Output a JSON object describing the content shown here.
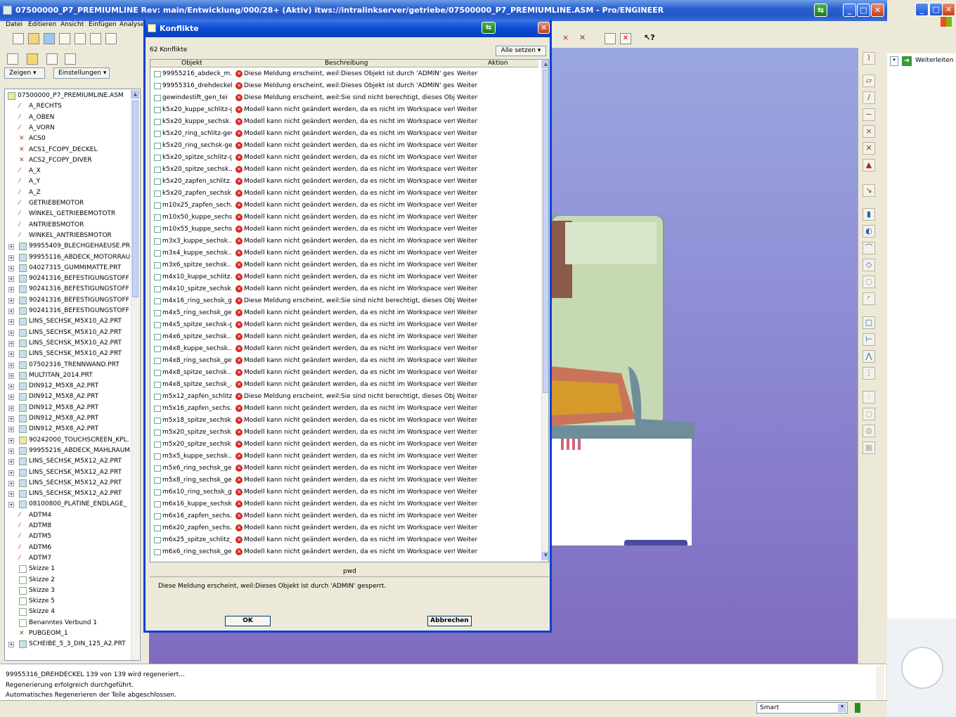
{
  "window": {
    "title": "07500000_P7_PREMIUMLINE Rev: main/Entwicklung/000/28+ (Aktiv) itws://intralinkserver/getriebe/07500000_P7_PREMIUMLINE.ASM - Pro/ENGINEER",
    "min": "_",
    "max": "□",
    "close": "✕"
  },
  "menu": [
    "Datei",
    "Editieren",
    "Ansicht",
    "Einfügen",
    "Analyse"
  ],
  "left_panel": {
    "zeigen": "Zeigen ▾",
    "einstellungen": "Einstellungen ▾",
    "tree": [
      {
        "label": "07500000_P7_PREMIUMLINE.ASM",
        "indent": 0,
        "expand": false,
        "kind": "asm"
      },
      {
        "label": "A_RECHTS",
        "indent": 1,
        "expand": false,
        "kind": "plane"
      },
      {
        "label": "A_OBEN",
        "indent": 1,
        "expand": false,
        "kind": "plane"
      },
      {
        "label": "A_VORN",
        "indent": 1,
        "expand": false,
        "kind": "plane"
      },
      {
        "label": "ACS0",
        "indent": 1,
        "expand": false,
        "kind": "csys"
      },
      {
        "label": "ACS1_FCOPY_DECKEL",
        "indent": 1,
        "expand": false,
        "kind": "csys"
      },
      {
        "label": "ACS2_FCOPY_DIVER",
        "indent": 1,
        "expand": false,
        "kind": "csys"
      },
      {
        "label": "A_X",
        "indent": 1,
        "expand": false,
        "kind": "axis"
      },
      {
        "label": "A_Y",
        "indent": 1,
        "expand": false,
        "kind": "axis"
      },
      {
        "label": "A_Z",
        "indent": 1,
        "expand": false,
        "kind": "axis"
      },
      {
        "label": "GETRIEBEMOTOR",
        "indent": 1,
        "expand": false,
        "kind": "axis"
      },
      {
        "label": "WINKEL_GETRIEBEMOTOTR",
        "indent": 1,
        "expand": false,
        "kind": "plane"
      },
      {
        "label": "ANTRIEBSMOTOR",
        "indent": 1,
        "expand": false,
        "kind": "axis"
      },
      {
        "label": "WINKEL_ANTRIEBSMOTOR",
        "indent": 1,
        "expand": false,
        "kind": "plane"
      },
      {
        "label": "99955409_BLECHGEHAEUSE.PR",
        "indent": 1,
        "expand": true,
        "kind": "part"
      },
      {
        "label": "99955116_ABDECK_MOTORRAU",
        "indent": 1,
        "expand": true,
        "kind": "part"
      },
      {
        "label": "04027315_GUMMIMATTE.PRT",
        "indent": 1,
        "expand": true,
        "kind": "part"
      },
      {
        "label": "90241316_BEFESTIGUNGSTOFF",
        "indent": 1,
        "expand": true,
        "kind": "part"
      },
      {
        "label": "90241316_BEFESTIGUNGSTOFF",
        "indent": 1,
        "expand": true,
        "kind": "part"
      },
      {
        "label": "90241316_BEFESTIGUNGSTOFF",
        "indent": 1,
        "expand": true,
        "kind": "part"
      },
      {
        "label": "90241316_BEFESTIGUNGSTOFF",
        "indent": 1,
        "expand": true,
        "kind": "part"
      },
      {
        "label": "LINS_SECHSK_M5X10_A2.PRT",
        "indent": 1,
        "expand": true,
        "kind": "part"
      },
      {
        "label": "LINS_SECHSK_M5X10_A2.PRT",
        "indent": 1,
        "expand": true,
        "kind": "part"
      },
      {
        "label": "LINS_SECHSK_M5X10_A2.PRT",
        "indent": 1,
        "expand": true,
        "kind": "part"
      },
      {
        "label": "LINS_SECHSK_M5X10_A2.PRT",
        "indent": 1,
        "expand": true,
        "kind": "part"
      },
      {
        "label": "07502316_TRENNWAND.PRT",
        "indent": 1,
        "expand": true,
        "kind": "part"
      },
      {
        "label": "MULTITAN_2014.PRT",
        "indent": 1,
        "expand": true,
        "kind": "part"
      },
      {
        "label": "DIN912_M5X8_A2.PRT",
        "indent": 1,
        "expand": true,
        "kind": "part"
      },
      {
        "label": "DIN912_M5X8_A2.PRT",
        "indent": 1,
        "expand": true,
        "kind": "part"
      },
      {
        "label": "DIN912_M5X8_A2.PRT",
        "indent": 1,
        "expand": true,
        "kind": "part"
      },
      {
        "label": "DIN912_M5X8_A2.PRT",
        "indent": 1,
        "expand": true,
        "kind": "part"
      },
      {
        "label": "DIN912_M5X8_A2.PRT",
        "indent": 1,
        "expand": true,
        "kind": "part"
      },
      {
        "label": "90242000_TOUCHSCREEN_KPL.",
        "indent": 1,
        "expand": true,
        "kind": "asm"
      },
      {
        "label": "99955216_ABDECK_MAHLRAUM.",
        "indent": 1,
        "expand": true,
        "kind": "part"
      },
      {
        "label": "LINS_SECHSK_M5X12_A2.PRT",
        "indent": 1,
        "expand": true,
        "kind": "part"
      },
      {
        "label": "LINS_SECHSK_M5X12_A2.PRT",
        "indent": 1,
        "expand": true,
        "kind": "part"
      },
      {
        "label": "LINS_SECHSK_M5X12_A2.PRT",
        "indent": 1,
        "expand": true,
        "kind": "part"
      },
      {
        "label": "LINS_SECHSK_M5X12_A2.PRT",
        "indent": 1,
        "expand": true,
        "kind": "part"
      },
      {
        "label": "08100800_PLATINE_ENDLAGE_",
        "indent": 1,
        "expand": true,
        "kind": "part"
      },
      {
        "label": "ADTM4",
        "indent": 1,
        "expand": false,
        "kind": "plane"
      },
      {
        "label": "ADTM8",
        "indent": 1,
        "expand": false,
        "kind": "plane"
      },
      {
        "label": "ADTM5",
        "indent": 1,
        "expand": false,
        "kind": "plane"
      },
      {
        "label": "ADTM6",
        "indent": 1,
        "expand": false,
        "kind": "plane"
      },
      {
        "label": "ADTM7",
        "indent": 1,
        "expand": false,
        "kind": "plane"
      },
      {
        "label": "Skizze 1",
        "indent": 1,
        "expand": false,
        "kind": "sketch"
      },
      {
        "label": "Skizze 2",
        "indent": 1,
        "expand": false,
        "kind": "sketch"
      },
      {
        "label": "Skizze 3",
        "indent": 1,
        "expand": false,
        "kind": "sketch"
      },
      {
        "label": "Skizze 5",
        "indent": 1,
        "expand": false,
        "kind": "sketch"
      },
      {
        "label": "Skizze 4",
        "indent": 1,
        "expand": false,
        "kind": "sketch"
      },
      {
        "label": "Benanntes Verbund 1",
        "indent": 1,
        "expand": false,
        "kind": "sketch"
      },
      {
        "label": "PUBGEOM_1",
        "indent": 1,
        "expand": false,
        "kind": "csys"
      },
      {
        "label": "SCHEIBE_5_3_DIN_125_A2.PRT",
        "indent": 1,
        "expand": true,
        "kind": "part"
      }
    ]
  },
  "dialog": {
    "title": "Konflikte",
    "close": "✕",
    "count_text": "62 Konflikte",
    "alle_setzen": "Alle setzen ▾",
    "columns": [
      "Objekt",
      "Beschreibung",
      "Aktion"
    ],
    "rows": [
      [
        "99955216_abdeck_m..",
        "Diese Meldung erscheint, weil:Dieses Objekt ist durch 'ADMIN' gesperrt.",
        "Weiter"
      ],
      [
        "99955316_drehdeckel",
        "Diese Meldung erscheint, weil:Dieses Objekt ist durch 'ADMIN' gesperrt.",
        "Weiter"
      ],
      [
        "gewindestift_gen_tei",
        "Diese Meldung erscheint, weil:Sie sind nicht berechtigt, dieses Objekt ei..",
        "Weiter"
      ],
      [
        "k5x20_kuppe_schlitz-g..",
        "Modell kann nicht geändert werden, da es nicht im Workspace verfügba..",
        "Weiter"
      ],
      [
        "k5x20_kuppe_sechsk..",
        "Modell kann nicht geändert werden, da es nicht im Workspace verfügba..",
        "Weiter"
      ],
      [
        "k5x20_ring_schlitz-gew..",
        "Modell kann nicht geändert werden, da es nicht im Workspace verfügba..",
        "Weiter"
      ],
      [
        "k5x20_ring_sechsk-ge..",
        "Modell kann nicht geändert werden, da es nicht im Workspace verfügba..",
        "Weiter"
      ],
      [
        "k5x20_spitze_schlitz-g..",
        "Modell kann nicht geändert werden, da es nicht im Workspace verfügba..",
        "Weiter"
      ],
      [
        "k5x20_spitze_sechsk..",
        "Modell kann nicht geändert werden, da es nicht im Workspace verfügba..",
        "Weiter"
      ],
      [
        "k5x20_zapfen_schlitz..",
        "Modell kann nicht geändert werden, da es nicht im Workspace verfügba..",
        "Weiter"
      ],
      [
        "k5x20_zapfen_sechsk..",
        "Modell kann nicht geändert werden, da es nicht im Workspace verfügba..",
        "Weiter"
      ],
      [
        "m10x25_zapfen_sech..",
        "Modell kann nicht geändert werden, da es nicht im Workspace verfügba..",
        "Weiter"
      ],
      [
        "m10x50_kuppe_sechs..",
        "Modell kann nicht geändert werden, da es nicht im Workspace verfügba..",
        "Weiter"
      ],
      [
        "m10x55_kuppe_sechs..",
        "Modell kann nicht geändert werden, da es nicht im Workspace verfügba..",
        "Weiter"
      ],
      [
        "m3x3_kuppe_sechsk..",
        "Modell kann nicht geändert werden, da es nicht im Workspace verfügba..",
        "Weiter"
      ],
      [
        "m3x4_kuppe_sechsk..",
        "Modell kann nicht geändert werden, da es nicht im Workspace verfügba..",
        "Weiter"
      ],
      [
        "m3x6_spitze_sechsk..",
        "Modell kann nicht geändert werden, da es nicht im Workspace verfügba..",
        "Weiter"
      ],
      [
        "m4x10_kuppe_schlitz..",
        "Modell kann nicht geändert werden, da es nicht im Workspace verfügba..",
        "Weiter"
      ],
      [
        "m4x10_spitze_sechsk..",
        "Modell kann nicht geändert werden, da es nicht im Workspace verfügba..",
        "Weiter"
      ],
      [
        "m4x16_ring_sechsk_g..",
        "Diese Meldung erscheint, weil:Sie sind nicht berechtigt, dieses Objekt ei..",
        "Weiter"
      ],
      [
        "m4x5_ring_sechsk_ge..",
        "Modell kann nicht geändert werden, da es nicht im Workspace verfügba..",
        "Weiter"
      ],
      [
        "m4x5_spitze_sechsk-g..",
        "Modell kann nicht geändert werden, da es nicht im Workspace verfügba..",
        "Weiter"
      ],
      [
        "m4x6_spitze_sechsk..",
        "Modell kann nicht geändert werden, da es nicht im Workspace verfügba..",
        "Weiter"
      ],
      [
        "m4x8_kuppe_sechsk..",
        "Modell kann nicht geändert werden, da es nicht im Workspace verfügba..",
        "Weiter"
      ],
      [
        "m4x8_ring_sechsk_ge..",
        "Modell kann nicht geändert werden, da es nicht im Workspace verfügba..",
        "Weiter"
      ],
      [
        "m4x8_spitze_sechsk..",
        "Modell kann nicht geändert werden, da es nicht im Workspace verfügba..",
        "Weiter"
      ],
      [
        "m4x8_spitze_sechsk_..",
        "Modell kann nicht geändert werden, da es nicht im Workspace verfügba..",
        "Weiter"
      ],
      [
        "m5x12_zapfen_schlitz..",
        "Diese Meldung erscheint, weil:Sie sind nicht berechtigt, dieses Objekt ei..",
        "Weiter"
      ],
      [
        "m5x16_zapfen_sechs..",
        "Modell kann nicht geändert werden, da es nicht im Workspace verfügba..",
        "Weiter"
      ],
      [
        "m5x18_spitze_sechsk..",
        "Modell kann nicht geändert werden, da es nicht im Workspace verfügba..",
        "Weiter"
      ],
      [
        "m5x20_spitze_sechsk..",
        "Modell kann nicht geändert werden, da es nicht im Workspace verfügba..",
        "Weiter"
      ],
      [
        "m5x20_spitze_sechsk..",
        "Modell kann nicht geändert werden, da es nicht im Workspace verfügba..",
        "Weiter"
      ],
      [
        "m5x5_kuppe_sechsk..",
        "Modell kann nicht geändert werden, da es nicht im Workspace verfügba..",
        "Weiter"
      ],
      [
        "m5x6_ring_sechsk_ge..",
        "Modell kann nicht geändert werden, da es nicht im Workspace verfügba..",
        "Weiter"
      ],
      [
        "m5x8_ring_sechsk_ge..",
        "Modell kann nicht geändert werden, da es nicht im Workspace verfügba..",
        "Weiter"
      ],
      [
        "m6x10_ring_sechsk_g..",
        "Modell kann nicht geändert werden, da es nicht im Workspace verfügba..",
        "Weiter"
      ],
      [
        "m6x16_kuppe_sechsk..",
        "Modell kann nicht geändert werden, da es nicht im Workspace verfügba..",
        "Weiter"
      ],
      [
        "m6x16_zapfen_sechs..",
        "Modell kann nicht geändert werden, da es nicht im Workspace verfügba..",
        "Weiter"
      ],
      [
        "m6x20_zapfen_sechs..",
        "Modell kann nicht geändert werden, da es nicht im Workspace verfügba..",
        "Weiter"
      ],
      [
        "m6x25_spitze_schlitz_..",
        "Modell kann nicht geändert werden, da es nicht im Workspace verfügba..",
        "Weiter"
      ],
      [
        "m6x6_ring_sechsk_ge..",
        "Modell kann nicht geändert werden, da es nicht im Workspace verfügba..",
        "Weiter"
      ]
    ],
    "pwd_label": "pwd",
    "detail": "Diese Meldung erscheint, weil:Dieses Objekt ist durch 'ADMIN' gesperrt.",
    "ok": "OK",
    "cancel": "Abbrechen"
  },
  "messages": [
    "99955316_DREHDECKEL 139 von 139 wird regeneriert...",
    "Regenerierung erfolgreich durchgeführt.",
    "Automatisches Regenerieren der Teile abgeschlossen."
  ],
  "status": {
    "filter": "Smart",
    "weiter": "Weiterleiten zu"
  },
  "colors": {
    "title_blue": "#2457c8",
    "error_red": "#d62a1e",
    "model_green": "#c7d9b3",
    "viewport_top": "#9aa7df",
    "viewport_bottom": "#7f6bbf"
  }
}
